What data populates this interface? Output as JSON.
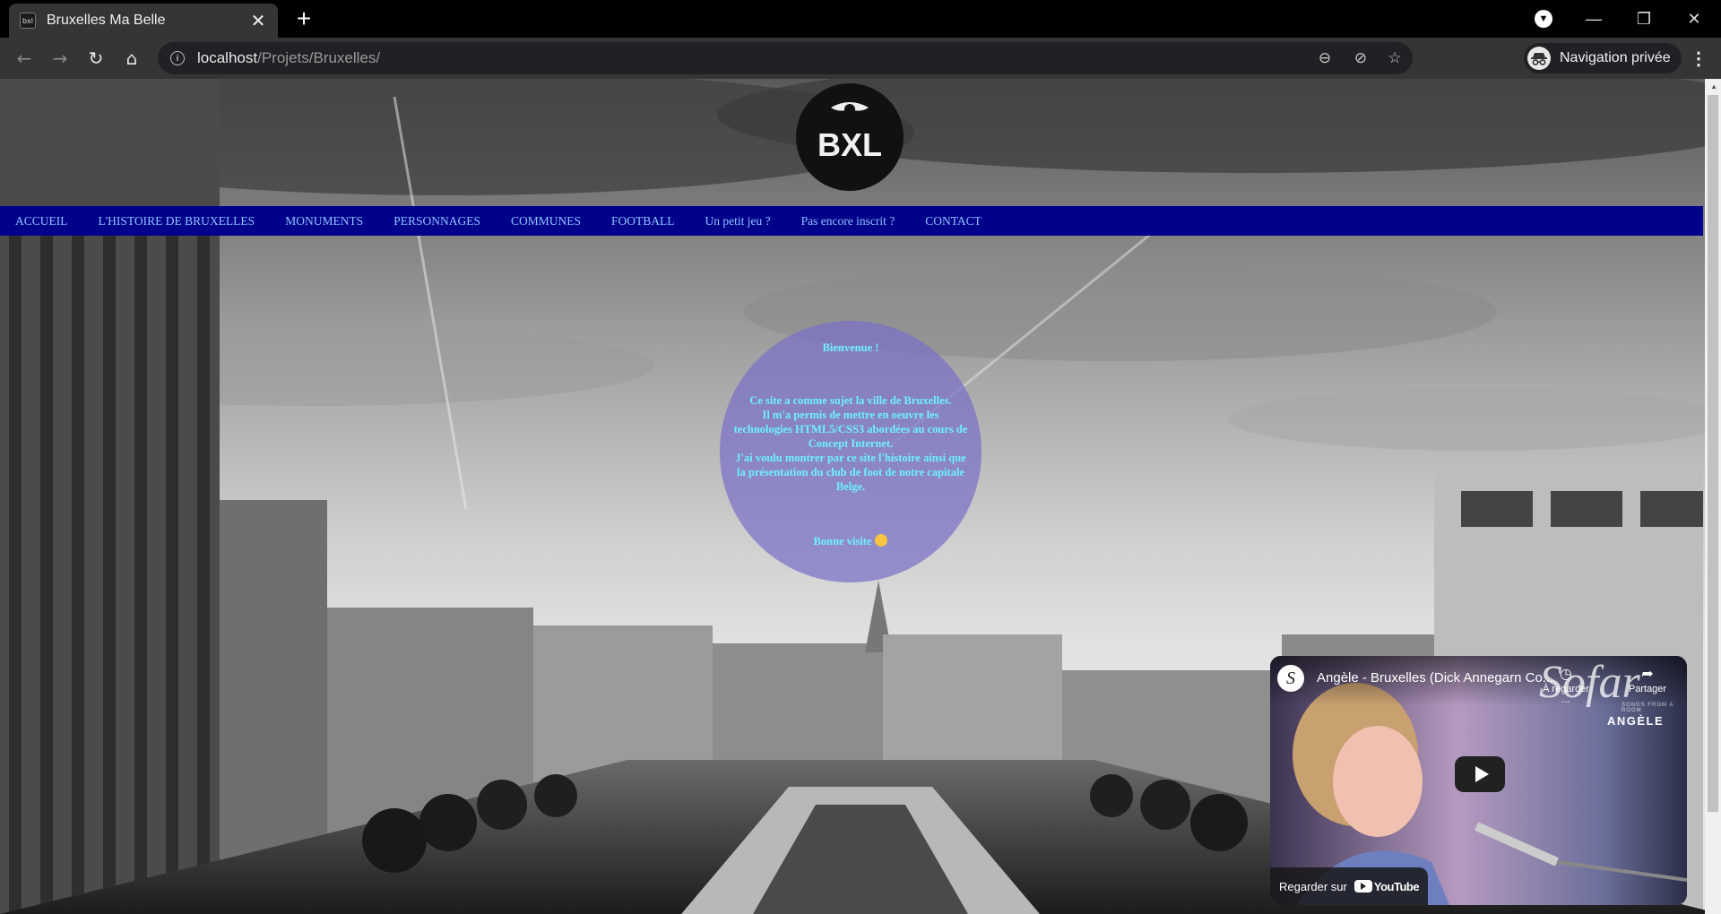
{
  "browser": {
    "tab_title": "Bruxelles Ma Belle",
    "favicon_text": "bxl",
    "url_host": "localhost",
    "url_path": "/Projets/Bruxelles/",
    "profile_label": "Navigation privée"
  },
  "site": {
    "logo_text": "BXL",
    "nav": [
      "ACCUEIL",
      "L'HISTOIRE DE BRUXELLES",
      "MONUMENTS",
      "PERSONNAGES",
      "COMMUNES",
      "FOOTBALL",
      "Un petit jeu ?",
      "Pas encore inscrit ?",
      "CONTACT"
    ],
    "nav_color": "#00008b",
    "welcome": {
      "title": "Bienvenue !",
      "line1": "Ce site a comme sujet la ville de Bruxelles.",
      "line2": "Il m'a permis de mettre en oeuvre les technologies HTML5/CSS3 abordées au cours de Concept Internet.",
      "line3": "J'ai voulu montrer par ce site l'histoire ainsi que la présentation du club de foot de notre capitale Belge.",
      "closing": "Bonne visite"
    }
  },
  "video": {
    "channel_avatar": "S",
    "title": "Angèle - Bruxelles (Dick Annegarn Co...",
    "watch_later_label": "À regarder ...",
    "share_label": "Partager",
    "watermark": "Sofar",
    "watermark_sub": "SONGS FROM A ROOM",
    "artist": "ANGÈLE",
    "watch_on_label": "Regarder sur",
    "platform_name": "YouTube"
  }
}
